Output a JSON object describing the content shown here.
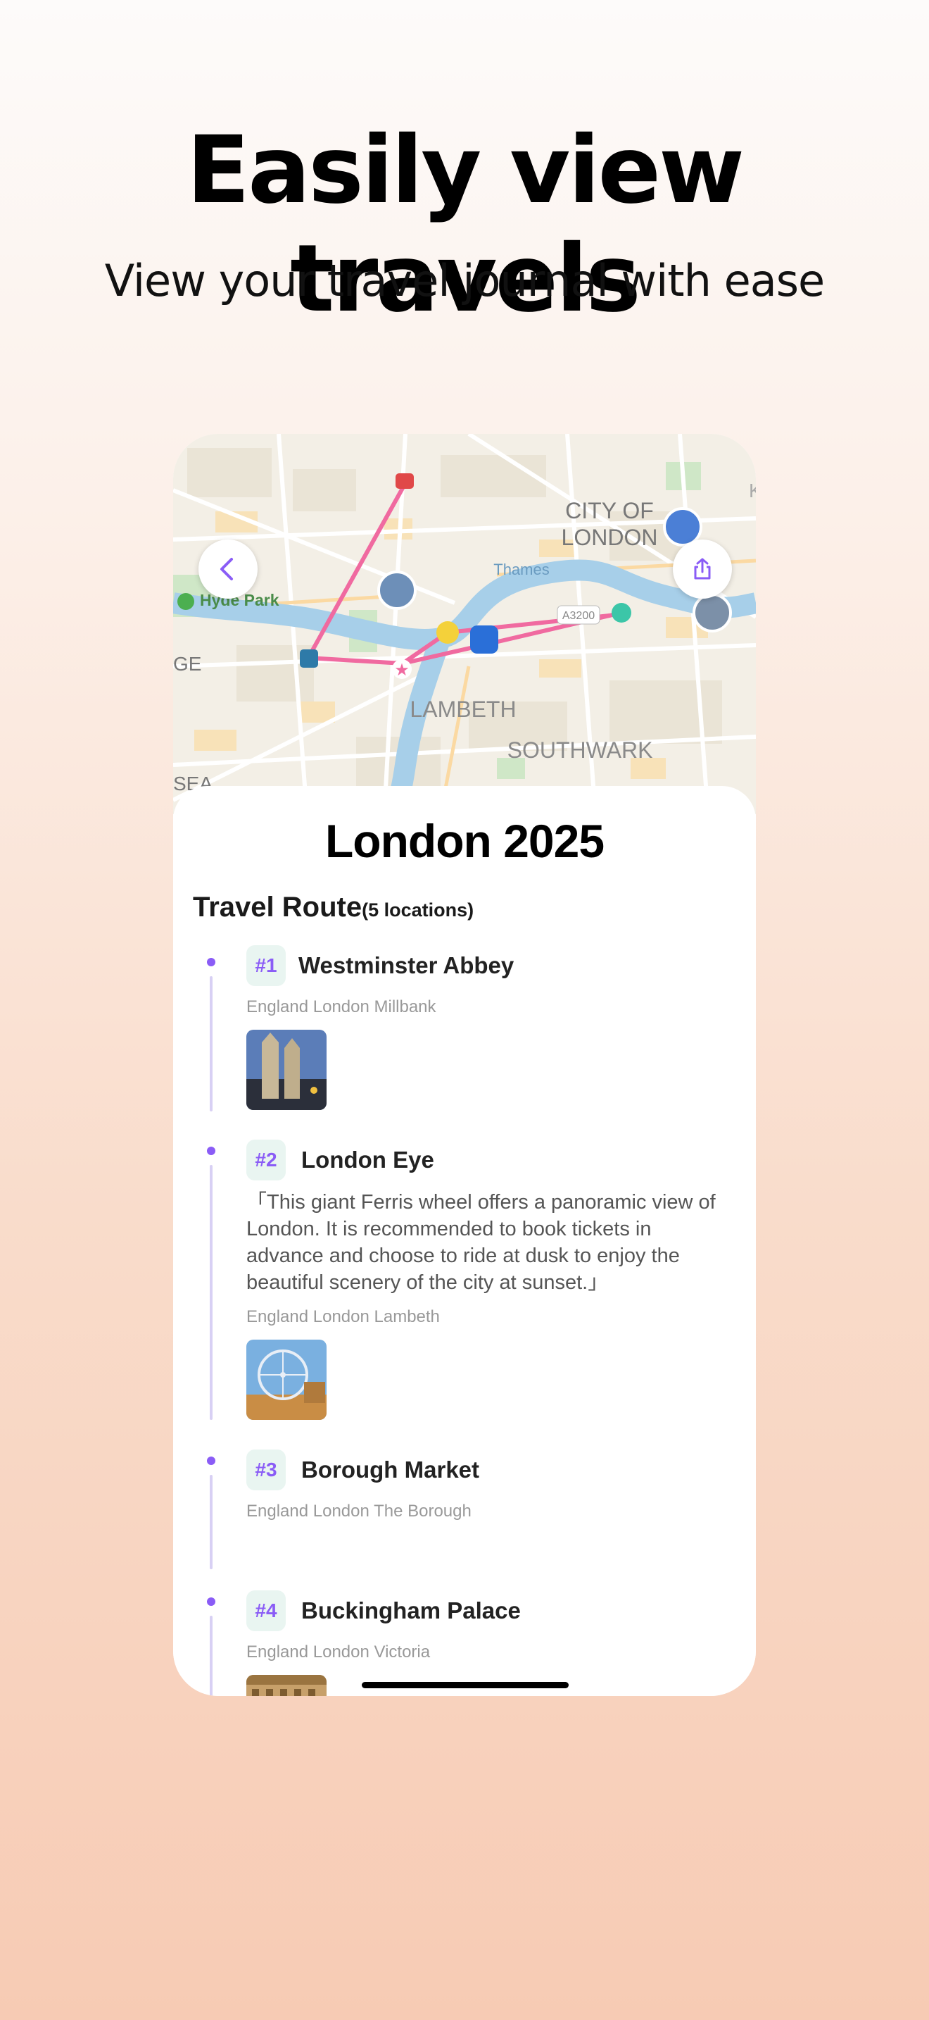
{
  "hero": {
    "headline": "Easily view travels",
    "subline": "View your travel journal with ease"
  },
  "map": {
    "labels": {
      "city_of_london": "CITY OF LONDON",
      "city_line1": "CITY OF",
      "city_line2": "LONDON",
      "thames": "Thames",
      "hyde_park": "Hyde Park",
      "a3200": "A3200",
      "lambeth": "LAMBETH",
      "southwark": "SOUTHWARK",
      "edge_left": "GE",
      "edge_left2": "SEA",
      "edge_right": "K"
    },
    "route_color": "#f06aa0",
    "back_icon": "chevron-left-icon",
    "share_icon": "share-icon"
  },
  "journal": {
    "title": "London 2025",
    "route_label": "Travel Route",
    "route_count": "(5 locations)",
    "stops": [
      {
        "badge": "#1",
        "name": "Westminster Abbey",
        "location": "England London Millbank",
        "note": ""
      },
      {
        "badge": "#2",
        "name": "London Eye",
        "location": "England London Lambeth",
        "note": "「This giant Ferris wheel offers a panoramic view of London. It is recommended to book tickets in advance and choose to ride at dusk to enjoy the beautiful scenery of the city at sunset.」"
      },
      {
        "badge": "#3",
        "name": "Borough Market",
        "location": "England London The Borough",
        "note": ""
      },
      {
        "badge": "#4",
        "name": "Buckingham Palace",
        "location": "England London Victoria",
        "note": ""
      }
    ]
  },
  "colors": {
    "accent": "#8a5cf6",
    "badge_bg": "#e9f5f1",
    "timeline": "#d8d0f4"
  }
}
